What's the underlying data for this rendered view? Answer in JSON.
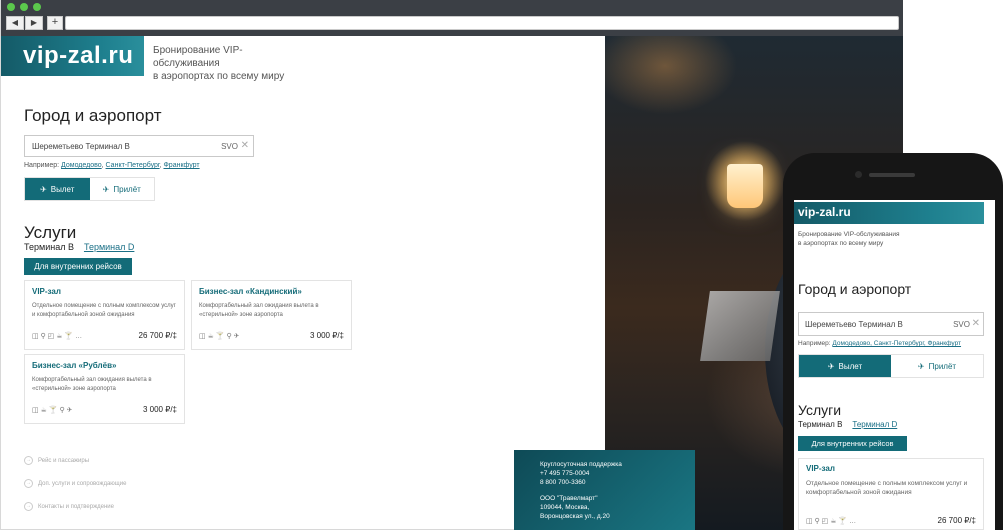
{
  "browser": {
    "back_glyph": "◀",
    "forward_glyph": "▶",
    "newtab_glyph": "+"
  },
  "site": {
    "logo": "vip-zal.ru",
    "tagline_line1": "Бронирование VIP-обслуживания",
    "tagline_line2": "в аэропортах по всему миру"
  },
  "search": {
    "heading": "Город и аэропорт",
    "value": "Шереметьево Терминал B",
    "code": "SVO",
    "clear_glyph": "✕",
    "example_prefix": "Например:",
    "examples": [
      "Домодедово",
      "Санкт-Петербург",
      "Франкфурт"
    ],
    "departure_label": "Вылет",
    "arrival_label": "Прилёт",
    "active_direction": "departure"
  },
  "services": {
    "heading": "Услуги",
    "terminal_current": "Терминал B",
    "terminal_other": "Терминал D",
    "filter_label": "Для внутренних рейсов",
    "cards": [
      {
        "title": "VIP-зал",
        "desc": "Отдельное помещение с полным комплексом услуг и комфортабельной зоной ожидания",
        "icons": [
          "lounge-icon",
          "person-icon",
          "cup-icon",
          "food-icon",
          "cocktail-icon",
          "more-icon"
        ],
        "icons_text": "◫ ⚲ ◰ ☕ 🍸 …",
        "price": "26 700 ₽/‡"
      },
      {
        "title": "Бизнес-зал «Кандинский»",
        "desc": "Комфортабельный зал ожидания вылета в «стерильной» зоне аэропорта",
        "icons_text": "◫ ☕ 🍸 ⚲ ✈",
        "price": "3 000 ₽/‡"
      },
      {
        "title": "Бизнес-зал «Рублёв»",
        "desc": "Комфортабельный зал ожидания вылета в «стерильной» зоне аэропорта",
        "icons_text": "◫ ☕ 🍸 ⚲ ✈",
        "price": "3 000 ₽/‡"
      }
    ]
  },
  "steps": [
    {
      "label": "Рейс и пассажиры"
    },
    {
      "label": "Доп. услуги и сопровождающие"
    },
    {
      "label": "Контакты и подтверждение"
    }
  ],
  "support": {
    "title": "Круглосуточная поддержка",
    "phone1": "+7 495 775-0004",
    "phone2": "8 800 700-3360",
    "company": "ООО \"Травелмарт\"",
    "addr1": "109044, Москва,",
    "addr2": "Воронцовская ул., д.20"
  },
  "mobile": {
    "logo": "vip-zal.ru",
    "tagline_line1": "Бронирование VIP-обслуживания",
    "tagline_line2": "в аэропортах по всему миру",
    "heading": "Город и аэропорт",
    "search_value": "Шереметьево Терминал B",
    "search_code": "SVO",
    "example_prefix": "Например:",
    "examples_text": "Домодедово, Санкт-Петербург, Франкфурт",
    "departure_label": "Вылет",
    "arrival_label": "Прилёт",
    "services_heading": "Услуги",
    "terminal_current": "Терминал B",
    "terminal_other": "Терминал D",
    "filter_label": "Для внутренних рейсов",
    "card_title": "VIP-зал",
    "card_desc": "Отдельное помещение с полным комплексом услуг и комфортабельной зоной ожидания",
    "card_icons_text": "◫ ⚲ ◰ ☕ 🍸 …",
    "card_price": "26 700 ₽/‡"
  },
  "colors": {
    "brand": "#136b78",
    "link": "#1a6f86"
  }
}
